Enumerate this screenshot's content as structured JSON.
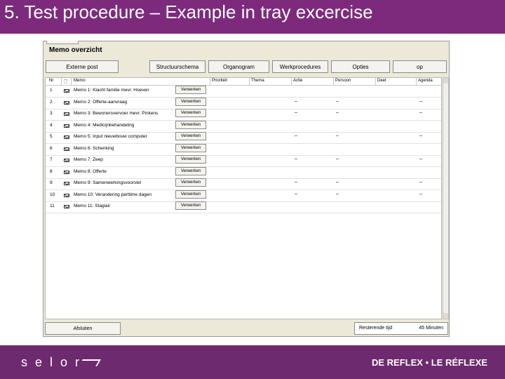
{
  "slide": {
    "title": "5. Test procedure – Example in tray excercise",
    "logo": "selor",
    "tagline": "DE REFLEX • LE RÉFLEXE"
  },
  "window": {
    "title": "Memo overzicht",
    "toolbar": [
      "Externe post",
      "Structuurschema",
      "Organogram",
      "Werkprocedures",
      "Opties",
      "op"
    ],
    "columns": [
      "Nr",
      "",
      "Memo",
      "",
      "Prioriteit",
      "Thema",
      "Actie",
      "Persoon",
      "Deel",
      "Agenda"
    ],
    "rows": [
      {
        "nr": "1",
        "memo": "Memo 1: Klacht familie mevr. Hoeven",
        "button": "Verwerken",
        "dashes": false
      },
      {
        "nr": "2",
        "memo": "Memo 2: Offerte-aanvraag",
        "button": "Verwerken",
        "dashes": true
      },
      {
        "nr": "3",
        "memo": "Memo 3: Bewonersvervoer mevr. Pinkens",
        "button": "Verwerken",
        "dashes": true
      },
      {
        "nr": "4",
        "memo": "Memo 4: Medicijnbehandeling",
        "button": "Verwerken",
        "dashes": false
      },
      {
        "nr": "5",
        "memo": "Memo 5: Input nieuwbouw computer",
        "button": "Verwerken",
        "dashes": true
      },
      {
        "nr": "6",
        "memo": "Memo 6: Schenking",
        "button": "Verwerken",
        "dashes": false
      },
      {
        "nr": "7",
        "memo": "Memo 7: Zeep",
        "button": "Verwerken",
        "dashes": true
      },
      {
        "nr": "8",
        "memo": "Memo 8: Offerte",
        "button": "Verwerken",
        "dashes": false
      },
      {
        "nr": "9",
        "memo": "Memo 9: Samenwerkingsvoorstel",
        "button": "Verwerken",
        "dashes": true
      },
      {
        "nr": "10",
        "memo": "Memo 10: Verandering parttime dagen",
        "button": "Verwerken",
        "dashes": true
      },
      {
        "nr": "11",
        "memo": "Memo 11: Stagiair",
        "button": "Verwerken",
        "dashes": false
      }
    ],
    "dash": "–",
    "footer_button": "Afsluiten",
    "time_label": "Resterende tijd",
    "time_value": "45 Minuten"
  }
}
